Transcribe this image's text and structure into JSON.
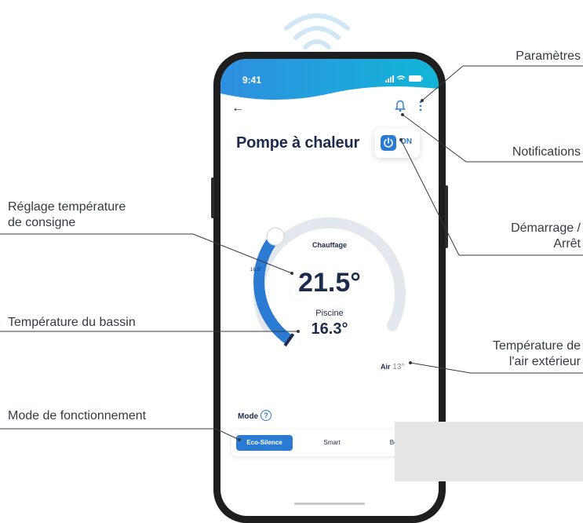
{
  "app": {
    "status_time": "9:41",
    "back_glyph": "←",
    "title": "Pompe à chaleur",
    "power_state": "ON",
    "mode_heading": "Chauffage",
    "gauge_min": "16.3°",
    "setpoint": "21.5°",
    "pool_label": "Piscine",
    "pool_temp": "16.3°",
    "air_label": "Air",
    "air_value": "13°",
    "mode_label": "Mode",
    "help_glyph": "?",
    "modes": [
      {
        "label": "Eco-Silence",
        "active": true
      },
      {
        "label": "Smart",
        "active": false
      },
      {
        "label": "Boost",
        "active": false
      }
    ]
  },
  "annotations": {
    "parametres": "Paramètres",
    "notifications": "Notifications",
    "demarrage_l1": "Démarrage /",
    "demarrage_l2": "Arrêt",
    "reglage_l1": "Réglage température",
    "reglage_l2": "de consigne",
    "bassin": "Température du bassin",
    "air_l1": "Température de",
    "air_l2": "l'air extérieur",
    "mode": "Mode de fonctionnement"
  },
  "gauge": {
    "fill_fraction": 0.38
  },
  "icons": [
    "wifi-icon",
    "signal-icon",
    "battery-icon",
    "back-arrow-icon",
    "bell-icon",
    "kebab-menu-icon",
    "power-icon",
    "help-icon"
  ],
  "colors": {
    "accent": "#2b7bd3",
    "header_from": "#2f8fe0",
    "header_to": "#12b5d8",
    "text_dark": "#1d2b4d",
    "track": "#e3e8ef",
    "wifi": "#cfe7f7"
  }
}
